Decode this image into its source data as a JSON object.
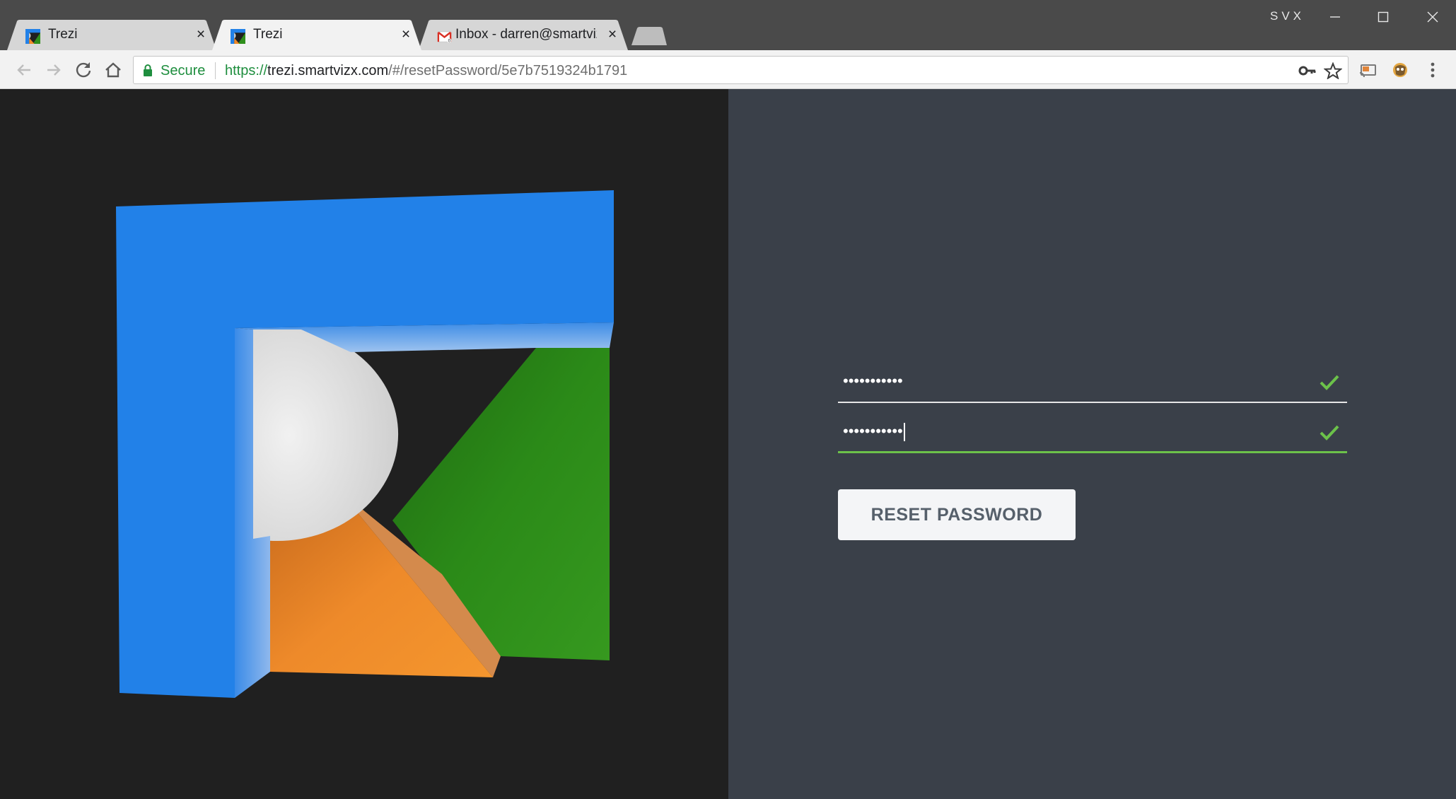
{
  "browser": {
    "tabs": [
      {
        "title": "Trezi",
        "active": false,
        "favicon": "trezi-logo-icon"
      },
      {
        "title": "Trezi",
        "active": true,
        "favicon": "trezi-logo-icon"
      },
      {
        "title": "Inbox - darren@smartvizx",
        "active": false,
        "favicon": "gmail-icon"
      }
    ],
    "close_glyph": "×",
    "profile_name": "SVX",
    "toolbar": {
      "secure_label": "Secure",
      "url_scheme": "https://",
      "url_host": "trezi.smartvizx.com",
      "url_path": "/#/resetPassword/5e7b7519324b1791"
    },
    "icons": [
      "back-arrow-icon",
      "forward-arrow-icon",
      "reload-icon",
      "home-icon",
      "lock-icon",
      "key-icon",
      "star-icon",
      "cast-icon",
      "extension-icon",
      "menu-dots-icon"
    ]
  },
  "form": {
    "new_password_mask": "•••••••••••",
    "confirm_password_mask": "•••••••••••",
    "reset_button_label": "RESET PASSWORD"
  },
  "colors": {
    "logo_blue": "#2281e8",
    "logo_green": "#2f8f1c",
    "logo_orange": "#ef8a28",
    "logo_white": "#e2e2e2",
    "valid_green": "#6cc24a",
    "panel_dark": "#202020",
    "panel_slate": "#3a4049"
  }
}
